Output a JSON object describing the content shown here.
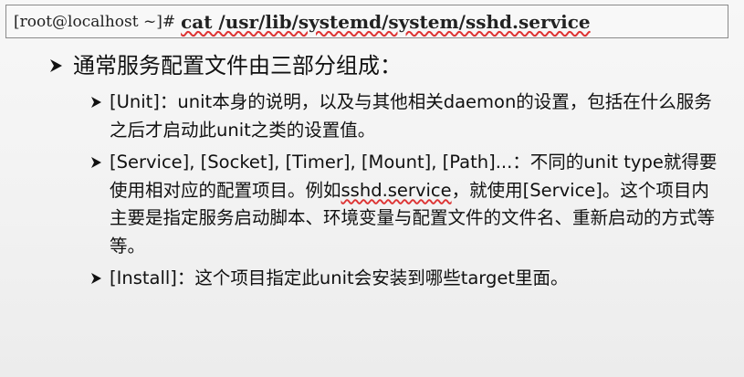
{
  "terminal": {
    "prompt": "[root@localhost ~]#",
    "command": "cat /usr/lib/systemd/system/sshd.service"
  },
  "heading": "通常服务配置文件由三部分组成：",
  "bullets": {
    "unit": "[Unit]：unit本身的说明，以及与其他相关daemon的设置，包括在什么服务之后才启动此unit之类的设置值。",
    "service_before": "[Service], [Socket], [Timer], [Mount], [Path]...：不同的unit type就得要使用相对应的配置项目。例如",
    "service_link": "sshd.service",
    "service_after": "，就使用[Service]。这个项目内主要是指定服务启动脚本、环境变量与配置文件的文件名、重新启动的方式等等。",
    "install": "[Install]：这个项目指定此unit会安装到哪些target里面。"
  }
}
